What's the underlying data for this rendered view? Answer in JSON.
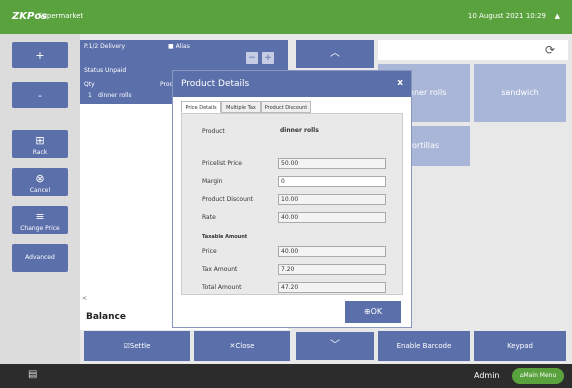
{
  "topbar": {
    "logo": "ZKPos",
    "store": "Supermarket",
    "datetime": "10 August 2021 10:29",
    "caret": "▲"
  },
  "left_buttons": [
    {
      "icon": "+",
      "label": ""
    },
    {
      "icon": "-",
      "label": ""
    },
    {
      "icon": "⊞",
      "label": "Rack"
    },
    {
      "icon": "⊗",
      "label": "Cancel"
    },
    {
      "icon": "≡",
      "label": "Change Price"
    },
    {
      "icon": "",
      "label": "Advanced"
    }
  ],
  "order": {
    "delivery": "P.1/2 Delivery",
    "alias": "■ Alias",
    "status": "Status  Unpaid",
    "columns": {
      "qty": "Qty",
      "product": "Product"
    },
    "rows": [
      {
        "qty": "1",
        "product": "dinner rolls"
      }
    ],
    "balance": "Balance",
    "scroll_left": "<"
  },
  "center": {
    "up": "︿",
    "down": "﹀"
  },
  "products": [
    "dinner rolls",
    "sandwich",
    "tortillas"
  ],
  "actions": {
    "settle": "☑Settle",
    "close": "✕Close",
    "barcode": "Enable Barcode",
    "keypad": "Keypad"
  },
  "footer": {
    "admin": "Admin",
    "main_menu": "⌂Main Menu"
  },
  "modal": {
    "title": "Product Details",
    "close": "x",
    "tabs": [
      "Price Details",
      "Multiple Tax",
      "Product Discount"
    ],
    "fields": {
      "product_label": "Product",
      "product_value": "dinner rolls",
      "pricelist_label": "Pricelist Price",
      "pricelist_value": "50.00",
      "margin_label": "Margin",
      "margin_value": "0",
      "discount_label": "Product Discount",
      "discount_value": "10.00",
      "rate_label": "Rate",
      "rate_value": "40.00",
      "taxable_header": "Taxable Amount",
      "price_label": "Price",
      "price_value": "40.00",
      "tax_label": "Tax Amount",
      "tax_value": "7.20",
      "total_label": "Total Amount",
      "total_value": "47.20"
    },
    "ok": "⊕OK"
  }
}
